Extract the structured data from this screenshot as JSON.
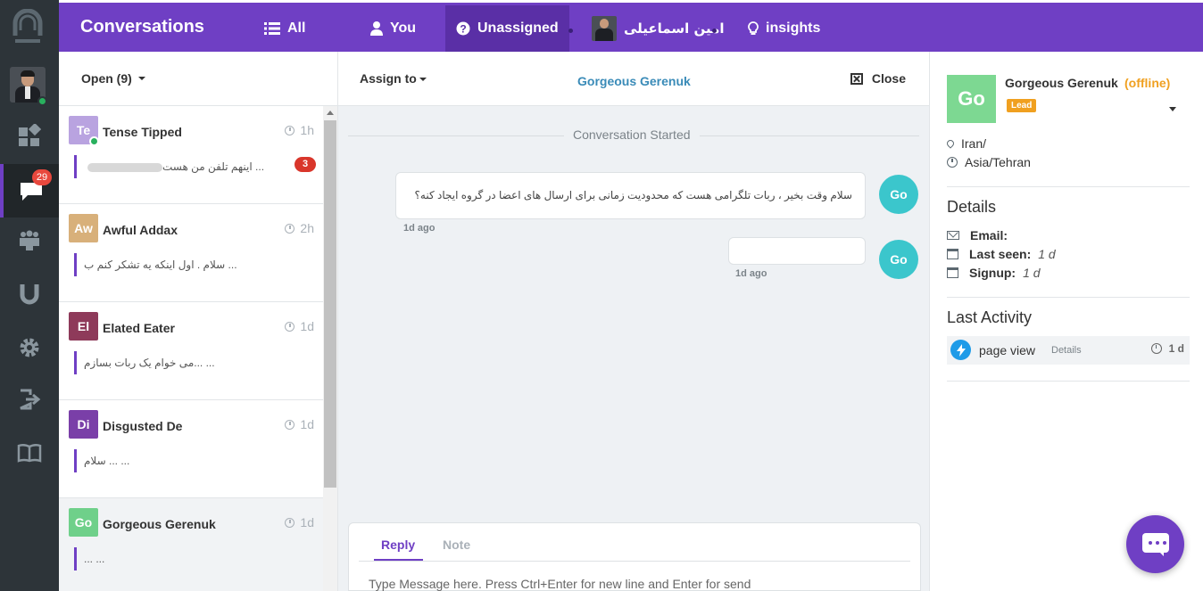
{
  "colors": {
    "accent": "#6f3fc4",
    "rail": "#2d3439",
    "online": "#29b05e",
    "badge": "#e8483d",
    "offline": "#f0a020",
    "link": "#3a8bb8"
  },
  "rail": {
    "items": [
      {
        "icon": "dashboard-icon"
      },
      {
        "icon": "chat-icon",
        "badge": "29"
      },
      {
        "icon": "team-icon"
      },
      {
        "icon": "magnet-icon"
      },
      {
        "icon": "gear-icon"
      },
      {
        "icon": "logout-icon"
      },
      {
        "icon": "book-icon"
      }
    ]
  },
  "topbar": {
    "title": "Conversations",
    "tabs": [
      {
        "label": "All",
        "icon": "list-icon"
      },
      {
        "label": "You",
        "icon": "user-icon"
      },
      {
        "label": "Unassigned",
        "icon": "question-icon"
      },
      {
        "label": "امین اسماعیلی",
        "icon": "avatar"
      },
      {
        "label": "insights",
        "icon": "lightbulb-icon"
      }
    ]
  },
  "list": {
    "filter_label": "Open (9)",
    "conversations": [
      {
        "initials": "Te",
        "avatar_color": "#b9a3e0",
        "name": "Tense Tipped",
        "time": "1h",
        "preview": "... اینهم تلفن من هست",
        "badge": "3",
        "online": true
      },
      {
        "initials": "Aw",
        "avatar_color": "#d8b07a",
        "name": "Awful Addax",
        "time": "2h",
        "preview": "... سلام . اول اینکه یه تشکر کنم ب"
      },
      {
        "initials": "El",
        "avatar_color": "#8e3a5a",
        "name": "Elated Eater",
        "time": "1d",
        "preview": "... ...می خوام یک ربات بسازم"
      },
      {
        "initials": "Di",
        "avatar_color": "#7a3fa8",
        "name": "Disgusted De",
        "time": "1d",
        "preview": "... ... سلام"
      },
      {
        "initials": "Go",
        "avatar_color": "#6fd08a",
        "name": "Gorgeous Gerenuk",
        "time": "1d",
        "preview": "... ..."
      }
    ]
  },
  "chat": {
    "assign_label": "Assign to",
    "title": "Gorgeous Gerenuk",
    "close_label": "Close",
    "started_label": "Conversation Started",
    "messages": [
      {
        "text": "سلام وقت بخیر ، ربات تلگرامی هست که محدودیت زمانی برای ارسال های اعضا در گروه ایجاد کنه؟",
        "time": "1d ago",
        "avatar": "Go"
      },
      {
        "text": "",
        "time": "1d ago",
        "avatar": "Go"
      }
    ],
    "reply_tab": "Reply",
    "note_tab": "Note",
    "input_placeholder": "Type Message here. Press Ctrl+Enter for new line and Enter for send"
  },
  "info": {
    "initials": "Go",
    "name": "Gorgeous Gerenuk",
    "status": "(offline)",
    "tag": "Lead",
    "location": "Iran/",
    "timezone": "Asia/Tehran",
    "details_heading": "Details",
    "email_label": "Email:",
    "email_value": "",
    "last_seen_label": "Last seen:",
    "last_seen_value": "1 d",
    "signup_label": "Signup:",
    "signup_value": "1 d",
    "activity_heading": "Last Activity",
    "activity": {
      "name": "page view",
      "details_label": "Details",
      "time": "1 d"
    }
  }
}
